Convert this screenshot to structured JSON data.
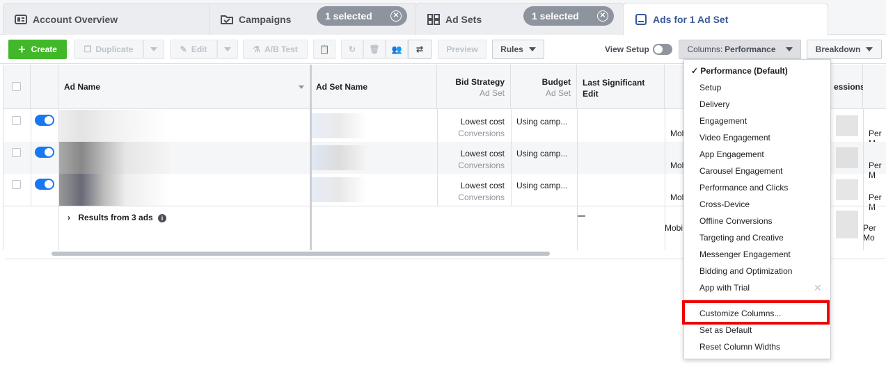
{
  "tabs": [
    {
      "label": "Account Overview"
    },
    {
      "label": "Campaigns",
      "selected": "1 selected"
    },
    {
      "label": "Ad Sets",
      "selected": "1 selected"
    },
    {
      "label": "Ads for 1 Ad Set"
    }
  ],
  "toolbar": {
    "create": "Create",
    "duplicate": "Duplicate",
    "edit": "Edit",
    "ab_test": "A/B Test",
    "preview": "Preview",
    "rules": "Rules",
    "view_setup": "View Setup",
    "columns_prefix": "Columns:",
    "columns_value": "Performance",
    "breakdown": "Breakdown"
  },
  "table": {
    "headers": {
      "ad_name": "Ad Name",
      "ad_set_name": "Ad Set Name",
      "bid_strategy": "Bid Strategy",
      "bid_strategy_sub": "Ad Set",
      "budget": "Budget",
      "budget_sub": "Ad Set",
      "last_edit": "Last Significant Edit",
      "impressions_partial": "essions"
    },
    "rows": [
      {
        "bid": "Lowest cost",
        "bid_sub": "Conversions",
        "budget": "Using camp...",
        "partial1": "Mol",
        "partial2": "Per M"
      },
      {
        "bid": "Lowest cost",
        "bid_sub": "Conversions",
        "budget": "Using camp...",
        "partial1": "Mol",
        "partial2": "Per M"
      },
      {
        "bid": "Lowest cost",
        "bid_sub": "Conversions",
        "budget": "Using camp...",
        "partial1": "Mol",
        "partial2": "Per M"
      }
    ],
    "summary": {
      "label": "Results from 3 ads",
      "dash": "—",
      "partial1": "Mobi",
      "partial2": "Per Mo"
    }
  },
  "dropdown": {
    "items": [
      "Performance (Default)",
      "Setup",
      "Delivery",
      "Engagement",
      "Video Engagement",
      "App Engagement",
      "Carousel Engagement",
      "Performance and Clicks",
      "Cross-Device",
      "Offline Conversions",
      "Targeting and Creative",
      "Messenger Engagement",
      "Bidding and Optimization",
      "App with Trial"
    ],
    "actions": [
      "Customize Columns...",
      "Set as Default",
      "Reset Column Widths"
    ]
  },
  "colors": {
    "accent": "#385898",
    "primary": "#42b72a",
    "toggle": "#1877f2",
    "highlight": "#e00000"
  }
}
